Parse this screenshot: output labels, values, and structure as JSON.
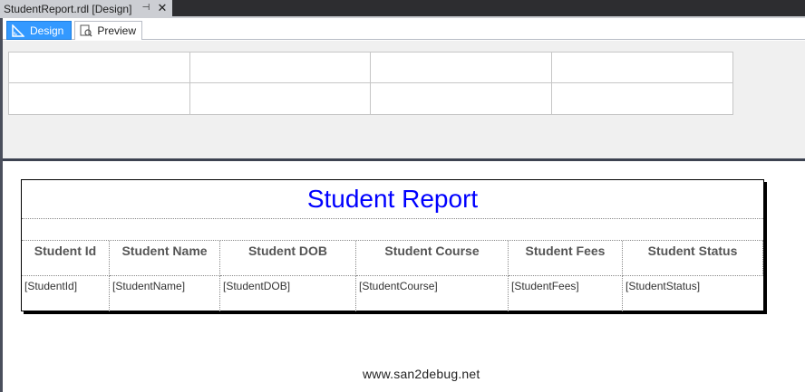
{
  "document_tab": {
    "title": "StudentReport.rdl [Design]",
    "pin_icon": "pin-icon",
    "close_icon": "close-icon"
  },
  "view_tabs": [
    {
      "label": "Design",
      "icon": "design-ruler-icon",
      "active": true
    },
    {
      "label": "Preview",
      "icon": "preview-icon",
      "active": false
    }
  ],
  "report": {
    "title": "Student Report",
    "title_color": "#0000ff",
    "columns": [
      "Student Id",
      "Student Name",
      "Student DOB",
      "Student Course",
      "Student Fees",
      "Student Status"
    ],
    "fields": [
      "[StudentId]",
      "[StudentName]",
      "[StudentDOB]",
      "[StudentCourse]",
      "[StudentFees]",
      "[StudentStatus]"
    ]
  },
  "watermark": "www.san2debug.net"
}
